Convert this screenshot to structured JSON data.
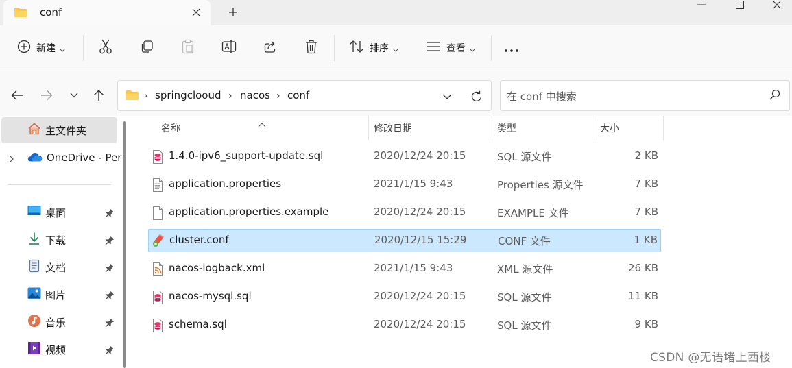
{
  "window": {
    "tab_title": "conf",
    "new_tab_symbol": "+",
    "controls": [
      "minimize",
      "maximize",
      "close"
    ]
  },
  "toolbar": {
    "new_label": "新建",
    "sort_label": "排序",
    "view_label": "查看",
    "more_label": "···",
    "icons": [
      "plus-circle-icon",
      "cut-icon",
      "copy-icon",
      "paste-icon",
      "rename-icon",
      "share-icon",
      "delete-icon",
      "sort-icon",
      "view-icon"
    ]
  },
  "address": {
    "crumbs": [
      "springclooud",
      "nacos",
      "conf"
    ],
    "separator": "›"
  },
  "search": {
    "placeholder": "在 conf 中搜索"
  },
  "sidebar": {
    "home": "主文件夹",
    "onedrive": "OneDrive - Per",
    "quick_access": [
      {
        "label": "桌面",
        "icon": "desktop-icon"
      },
      {
        "label": "下载",
        "icon": "download-icon"
      },
      {
        "label": "文档",
        "icon": "document-icon"
      },
      {
        "label": "图片",
        "icon": "picture-icon"
      },
      {
        "label": "音乐",
        "icon": "music-icon"
      },
      {
        "label": "视频",
        "icon": "video-icon"
      }
    ]
  },
  "columns": {
    "name": "名称",
    "modified": "修改日期",
    "type": "类型",
    "size": "大小"
  },
  "files": [
    {
      "name": "1.4.0-ipv6_support-update.sql",
      "modified": "2020/12/24 20:15",
      "type": "SQL 源文件",
      "size": "2 KB",
      "icon": "sql"
    },
    {
      "name": "application.properties",
      "modified": "2021/1/15 9:43",
      "type": "Properties 源文件",
      "size": "7 KB",
      "icon": "text"
    },
    {
      "name": "application.properties.example",
      "modified": "2020/12/24 20:15",
      "type": "EXAMPLE 文件",
      "size": "7 KB",
      "icon": "blank"
    },
    {
      "name": "cluster.conf",
      "modified": "2020/12/15 15:29",
      "type": "CONF 文件",
      "size": "1 KB",
      "icon": "conf"
    },
    {
      "name": "nacos-logback.xml",
      "modified": "2021/1/15 9:43",
      "type": "XML 源文件",
      "size": "26 KB",
      "icon": "xml"
    },
    {
      "name": "nacos-mysql.sql",
      "modified": "2020/12/24 20:15",
      "type": "SQL 源文件",
      "size": "11 KB",
      "icon": "sql"
    },
    {
      "name": "schema.sql",
      "modified": "2020/12/24 20:15",
      "type": "SQL 源文件",
      "size": "9 KB",
      "icon": "sql"
    }
  ],
  "selected_file": "cluster.conf",
  "watermark": "CSDN @无语堵上西楼",
  "colors": {
    "selection": "#cce8ff",
    "folder": "#f8c449",
    "accent": "#0067c0"
  }
}
